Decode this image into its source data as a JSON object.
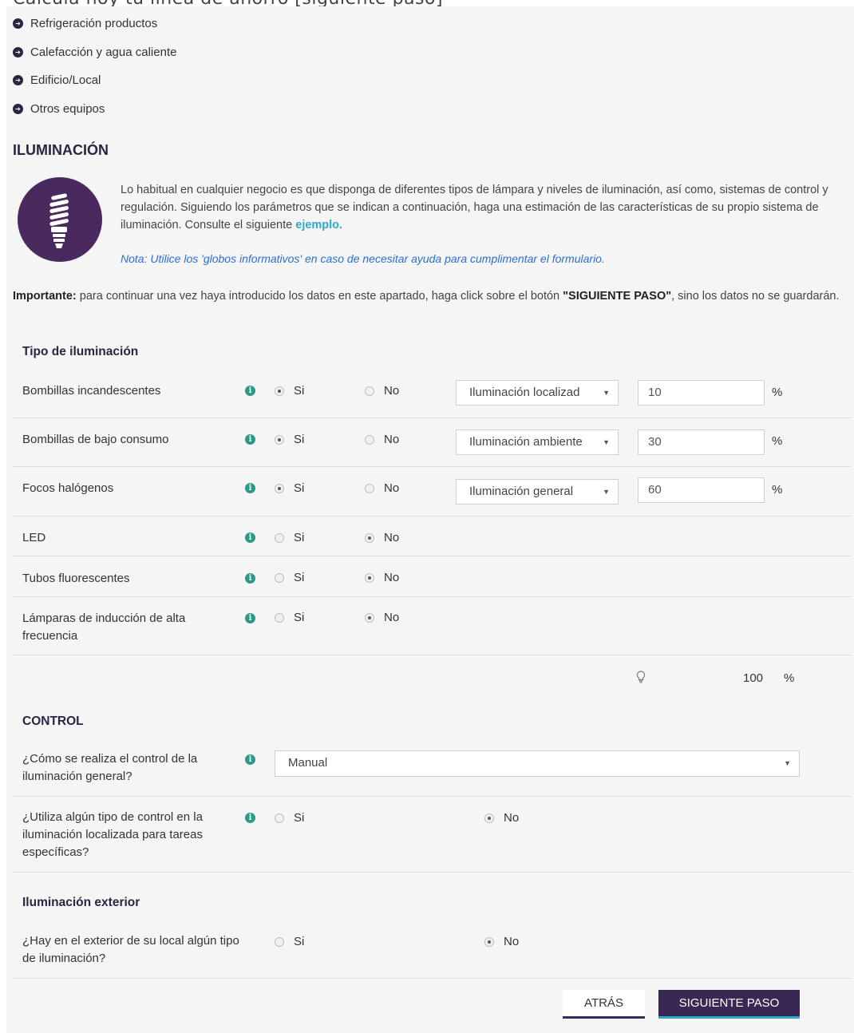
{
  "header_cut_text": "Calcula hoy tu línea de ahorro [siguiente paso]",
  "nav": {
    "items": [
      {
        "label": "Refrigeración productos"
      },
      {
        "label": "Calefacción y agua caliente"
      },
      {
        "label": "Edificio/Local"
      },
      {
        "label": "Otros equipos"
      }
    ]
  },
  "section": {
    "title": "ILUMINACIÓN",
    "icon": "lightbulb-icon",
    "intro": "Lo habitual en cualquier negocio es que disponga de diferentes tipos de lámpara y niveles de iluminación,  así como, sistemas de control y regulación. Siguiendo los parámetros que se indican a continuación, haga una estimación de las características de su propio sistema de iluminación. Consulte el siguiente",
    "intro_link": "ejemplo.",
    "nota": "Nota: Utilice los 'globos informativos' en caso de necesitar ayuda para cumplimentar el formulario.",
    "importante_label": "Importante:",
    "importante_text_1": " para continuar una vez haya introducido los datos en este apartado, haga click sobre el botón ",
    "importante_button_ref": "\"SIGUIENTE PASO\"",
    "importante_text_2": ", sino los datos no se guardarán."
  },
  "tipo": {
    "title": "Tipo de iluminación",
    "rows": [
      {
        "label": "Bombillas incandescentes",
        "si": "Si",
        "no": "No",
        "selected": "si",
        "select_value": "Iluminación localizad",
        "percent": "10",
        "unit": "%"
      },
      {
        "label": "Bombillas de bajo consumo",
        "si": "Si",
        "no": "No",
        "selected": "si",
        "select_value": "Iluminación ambiente",
        "percent": "30",
        "unit": "%"
      },
      {
        "label": "Focos halógenos",
        "si": "Si",
        "no": "No",
        "selected": "si",
        "select_value": "Iluminación general",
        "percent": "60",
        "unit": "%"
      },
      {
        "label": "LED",
        "si": "Si",
        "no": "No",
        "selected": "no"
      },
      {
        "label": "Tubos fluorescentes",
        "si": "Si",
        "no": "No",
        "selected": "no"
      },
      {
        "label": "Lámparas de inducción de alta frecuencia",
        "si": "Si",
        "no": "No",
        "selected": "no"
      }
    ],
    "total_value": "100",
    "total_unit": "%"
  },
  "control": {
    "title": "CONTROL",
    "q1_label": "¿Cómo se realiza el control de la iluminación general?",
    "q1_value": "Manual",
    "q2_label": "¿Utiliza algún tipo de control en la iluminación localizada para tareas específicas?",
    "q2_si": "Si",
    "q2_no": "No",
    "q2_selected": "no"
  },
  "exterior": {
    "title": "Iluminación exterior",
    "q_label": "¿Hay en el exterior de su local algún tipo de iluminación?",
    "si": "Si",
    "no": "No",
    "selected": "no"
  },
  "buttons": {
    "back": "ATRÁS",
    "next": "SIGUIENTE PASO"
  }
}
